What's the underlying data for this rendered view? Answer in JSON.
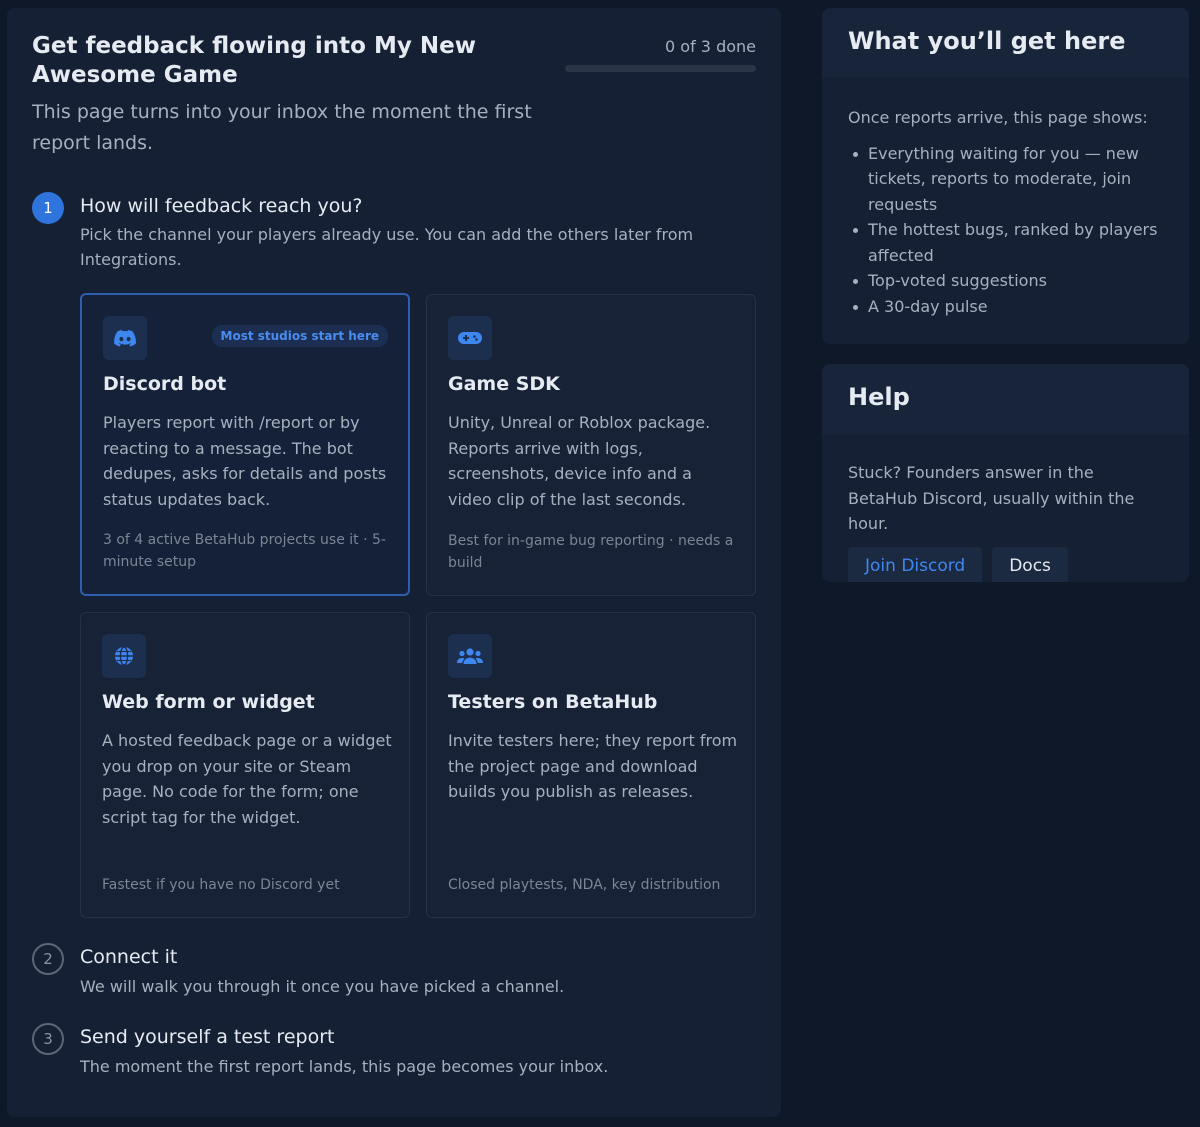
{
  "onboarding": {
    "title": "Get feedback flowing into My New Awesome Game",
    "subtitle": "This page turns into your inbox the moment the first report lands.",
    "progress_text": "0 of 3 done",
    "progress_fraction": 0,
    "steps": [
      {
        "number": "1",
        "title": "How will feedback reach you?",
        "description": "Pick the channel your players already use. You can add the others later from Integrations."
      },
      {
        "number": "2",
        "title": "Connect it",
        "description": "We will walk you through it once you have picked a channel."
      },
      {
        "number": "3",
        "title": "Send yourself a test report",
        "description": "The moment the first report lands, this page becomes your inbox."
      }
    ],
    "channels": [
      {
        "icon": "discord-icon",
        "badge": "Most studios start here",
        "title": "Discord bot",
        "description": "Players report with /report or by reacting to a message. The bot dedupes, asks for details and posts status updates back.",
        "footer": "3 of 4 active BetaHub projects use it · 5-minute setup"
      },
      {
        "icon": "gamepad-icon",
        "title": "Game SDK",
        "description": "Unity, Unreal or Roblox package. Reports arrive with logs, screenshots, device info and a video clip of the last seconds.",
        "footer": "Best for in-game bug reporting · needs a build"
      },
      {
        "icon": "globe-icon",
        "title": "Web form or widget",
        "description": "A hosted feedback page or a widget you drop on your site or Steam page. No code for the form; one script tag for the widget.",
        "footer": "Fastest if you have no Discord yet"
      },
      {
        "icon": "users-icon",
        "title": "Testers on BetaHub",
        "description": "Invite testers here; they report from the project page and download builds you publish as releases.",
        "footer": "Closed playtests, NDA, key distribution"
      }
    ]
  },
  "sidebar": {
    "what_you_get": {
      "title": "What you’ll get here",
      "intro": "Once reports arrive, this page shows:",
      "items": [
        "Everything waiting for you — new tickets, reports to moderate, join requests",
        "The hottest bugs, ranked by players affected",
        "Top-voted suggestions",
        "A 30-day pulse"
      ]
    },
    "help": {
      "title": "Help",
      "text": "Stuck? Founders answer in the BetaHub Discord, usually within the hour.",
      "join_label": "Join Discord",
      "docs_label": "Docs"
    }
  },
  "colors": {
    "background": "#0f1829",
    "panel": "#152034",
    "accent": "#2f74dd",
    "badge_text": "#4a8cf0"
  }
}
